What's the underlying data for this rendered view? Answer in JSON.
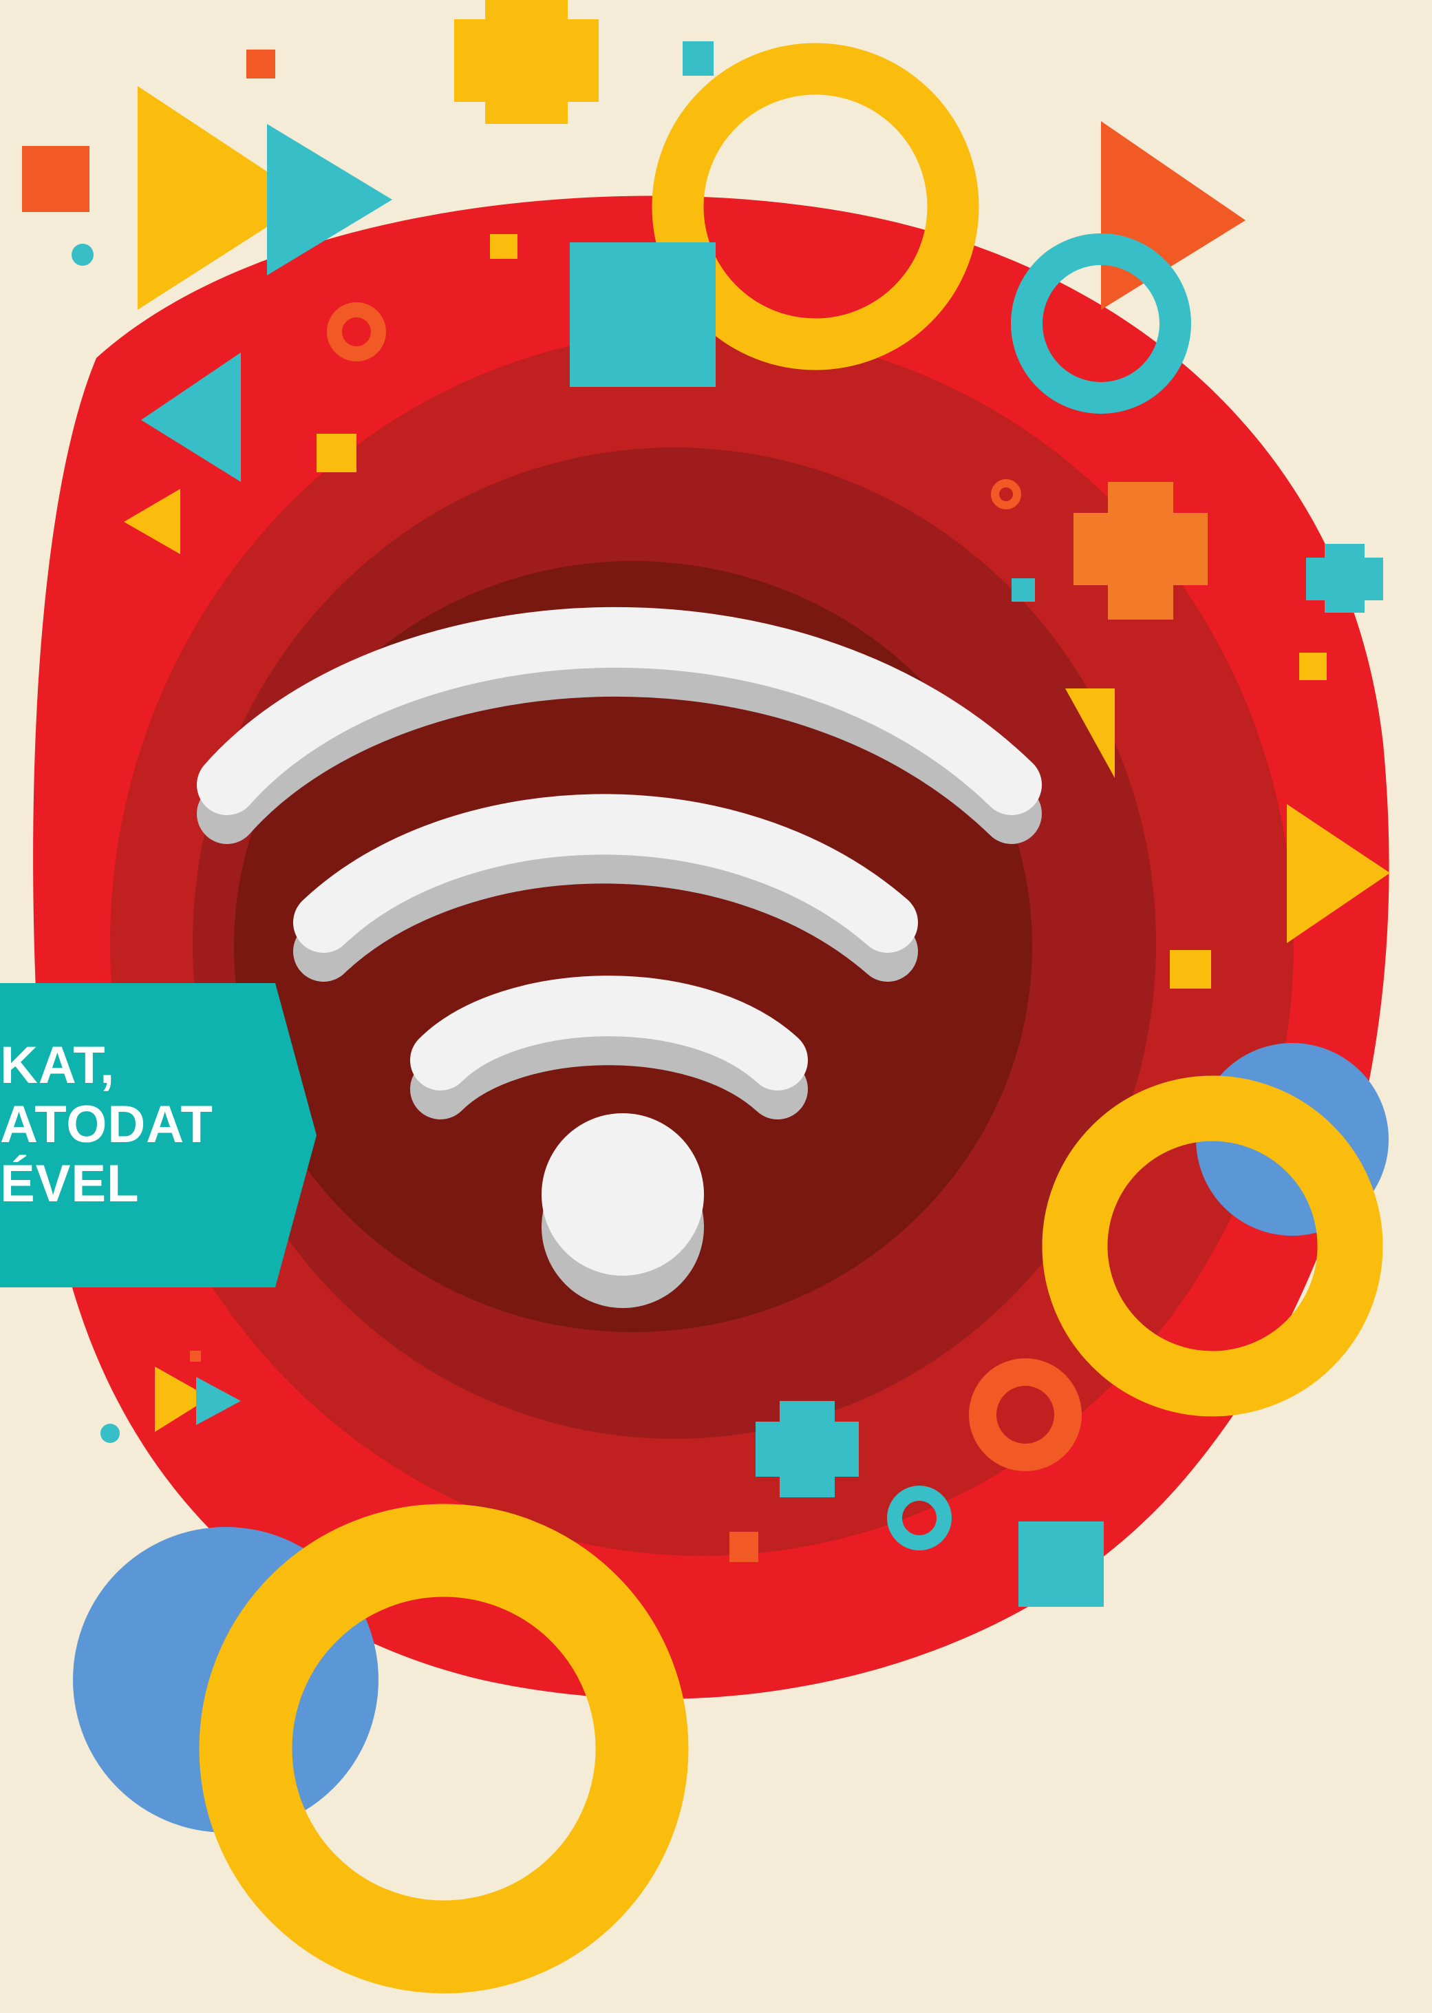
{
  "colors": {
    "background": "#f4ecd6",
    "red_outer": "#ea1c24",
    "red_mid": "#c0201f",
    "red_inner": "#9f1c1c",
    "red_core": "#781810",
    "yellow": "#fbbd0d",
    "teal": "#37bec6",
    "orange": "#f15a25",
    "orange_light": "#f37a29",
    "blue": "#5b96d6",
    "banner": "#0fb3ad",
    "wifi_white": "#f2f2f2",
    "wifi_shadow": "#bdbdbd"
  },
  "icons": {
    "wifi": "wifi-icon"
  },
  "banner": {
    "lines": [
      "KAT,",
      "ATODAT",
      "ÉVEL"
    ]
  }
}
